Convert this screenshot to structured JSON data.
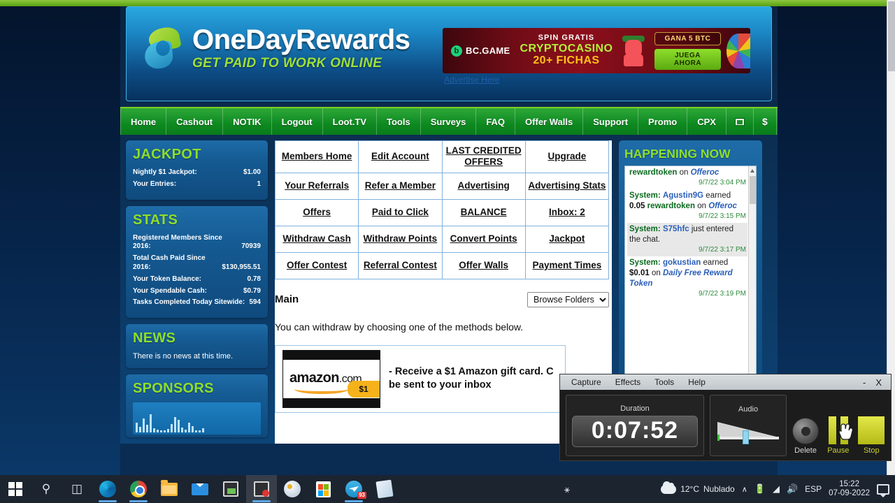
{
  "site": {
    "brand_name": "OneDayRewards",
    "tagline": "GET PAID TO WORK ONLINE",
    "advertise_link": "Advertise Here"
  },
  "ad": {
    "brand": "BC.GAME",
    "badge": "b",
    "line1": "SPIN GRATIS",
    "line2": "CRYPTOCASINO",
    "line3": "20+ FICHAS",
    "offer_badge": "GANA 5 BTC",
    "cta": "JUEGA AHORA"
  },
  "nav": {
    "items": [
      {
        "label": "Home",
        "icon": null
      },
      {
        "label": "Cashout",
        "icon": null
      },
      {
        "label": "NOTIK",
        "icon": null
      },
      {
        "label": "Logout",
        "icon": null
      },
      {
        "label": "Loot.TV",
        "icon": null
      },
      {
        "label": "Tools",
        "icon": null
      },
      {
        "label": "Surveys",
        "icon": null
      },
      {
        "label": "FAQ",
        "icon": null
      },
      {
        "label": "Offer Walls",
        "icon": null
      },
      {
        "label": "Support",
        "icon": null
      },
      {
        "label": "Promo",
        "icon": null
      },
      {
        "label": "CPX",
        "icon": null
      }
    ],
    "mail_icon": "mail-icon",
    "dollar_label": "$"
  },
  "jackpot": {
    "title": "JACKPOT",
    "rows": [
      {
        "label": "Nightly $1 Jackpot:",
        "value": "$1.00"
      },
      {
        "label": "Your Entries:",
        "value": "1"
      }
    ]
  },
  "stats": {
    "title": "STATS",
    "rows": [
      {
        "label": "Registered Members Since 2016:",
        "value": "70939"
      },
      {
        "label": "Total Cash Paid Since 2016:",
        "value": "$130,955.51"
      },
      {
        "label": "Your Token Balance:",
        "value": "0.78"
      },
      {
        "label": "Your Spendable Cash:",
        "value": "$0.79"
      },
      {
        "label": "Tasks Completed Today Sitewide:",
        "value": "594"
      }
    ]
  },
  "news": {
    "title": "NEWS",
    "text": "There is no news at this time."
  },
  "sponsors": {
    "title": "SPONSORS"
  },
  "menu_grid": {
    "rows": [
      [
        "Members Home",
        "Edit Account",
        "LAST CREDITED OFFERS",
        "Upgrade"
      ],
      [
        "Your Referrals",
        "Refer a Member",
        "Advertising",
        "Advertising Stats"
      ],
      [
        "Offers",
        "Paid to Click",
        "BALANCE",
        "Inbox: 2"
      ],
      [
        "Withdraw Cash",
        "Withdraw Points",
        "Convert Points",
        "Jackpot"
      ],
      [
        "Offer Contest",
        "Referral Contest",
        "Offer Walls",
        "Payment Times"
      ]
    ]
  },
  "main": {
    "title": "Main",
    "browse_folders": "Browse Folders",
    "withdraw_text": "You can withdraw by choosing one of the methods below.",
    "amazon": {
      "logo_text": "amazon",
      "logo_suffix": ".com",
      "price": "$1",
      "description": "- Receive a $1 Amazon gift card. C be sent to your inbox"
    }
  },
  "happening": {
    "title": "HAPPENING NOW",
    "messages": [
      {
        "partial": true,
        "token": "rewardtoken",
        "on": "on",
        "offer": "Offeroc",
        "time": "9/7/22 3:04 PM"
      },
      {
        "sys": "System:",
        "user": "Agustin9G",
        "verb": "earned",
        "amount": "0.05",
        "token": "rewardtoken",
        "on": "on",
        "offer": "Offeroc",
        "time": "9/7/22 3:15 PM"
      },
      {
        "sys": "System:",
        "user": "S75hfc",
        "verb": "just entered the chat.",
        "time": "9/7/22 3:17 PM"
      },
      {
        "sys": "System:",
        "user": "gokustian",
        "verb": "earned",
        "amount": "$0.01",
        "on": "on",
        "offer": "Daily Free Reward Token",
        "time": "9/7/22 3:19 PM"
      }
    ]
  },
  "recorder": {
    "menu": [
      "Capture",
      "Effects",
      "Tools",
      "Help"
    ],
    "minimize": "-",
    "close": "X",
    "duration_label": "Duration",
    "duration_value": "0:07:52",
    "audio_label": "Audio",
    "buttons": [
      {
        "name": "Delete",
        "label": "Delete"
      },
      {
        "name": "Pause",
        "label": "Pause"
      },
      {
        "name": "Stop",
        "label": "Stop"
      }
    ]
  },
  "taskbar": {
    "items": [
      {
        "name": "start-button",
        "icon": "windows-icon"
      },
      {
        "name": "search-button",
        "icon": "search-icon"
      },
      {
        "name": "task-view-button",
        "icon": "task-view-icon"
      },
      {
        "name": "edge-button",
        "icon": "edge-icon"
      },
      {
        "name": "chrome-button",
        "icon": "chrome-icon"
      },
      {
        "name": "file-explorer-button",
        "icon": "folder-icon"
      },
      {
        "name": "mail-button",
        "icon": "mail-icon"
      },
      {
        "name": "photos-button",
        "icon": "photo-icon"
      },
      {
        "name": "recorder-button",
        "icon": "photo-record-icon"
      },
      {
        "name": "paint-button",
        "icon": "paint-icon"
      },
      {
        "name": "store-button",
        "icon": "store-icon"
      },
      {
        "name": "telegram-button",
        "icon": "telegram-icon",
        "badge": "93"
      },
      {
        "name": "notes-button",
        "icon": "notes-icon"
      }
    ],
    "tray": {
      "people_icon": "people-icon",
      "temperature": "12°C",
      "weather": "Nublado",
      "chevron": "∧",
      "battery_icon": "battery-icon",
      "wifi_icon": "wifi-icon",
      "volume_icon": "volume-icon",
      "language": "ESP",
      "time": "15:22",
      "date": "07-09-2022"
    }
  }
}
